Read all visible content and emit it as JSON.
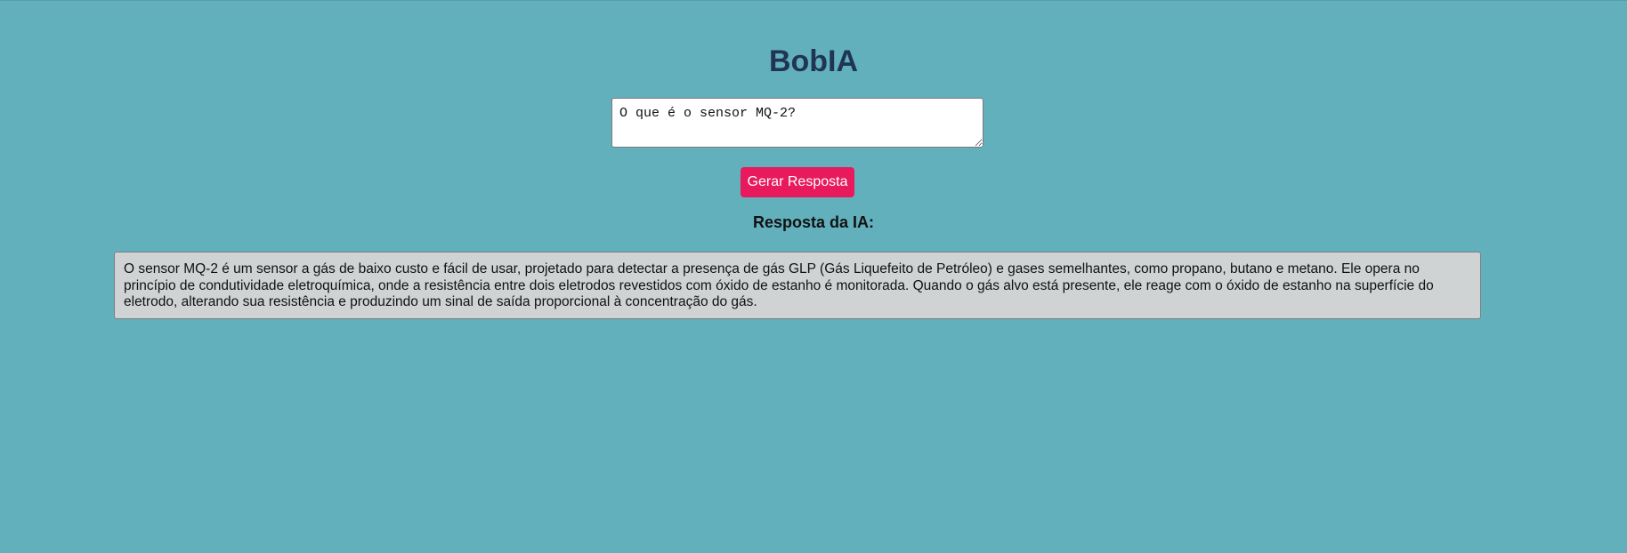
{
  "app": {
    "title": "BobIA"
  },
  "prompt": {
    "value": "O que é o sensor MQ-2?"
  },
  "actions": {
    "generate_label": "Gerar Resposta"
  },
  "response": {
    "heading": "Resposta da IA:",
    "text": "O sensor MQ-2 é um sensor a gás de baixo custo e fácil de usar, projetado para detectar a presença de gás GLP (Gás Liquefeito de Petróleo) e gases semelhantes, como propano, butano e metano. Ele opera no princípio de condutividade eletroquímica, onde a resistência entre dois eletrodos revestidos com óxido de estanho é monitorada. Quando o gás alvo está presente, ele reage com o óxido de estanho na superfície do eletrodo, alterando sua resistência e produzindo um sinal de saída proporcional à concentração do gás."
  },
  "colors": {
    "background": "#63b0bd",
    "title": "#1f3553",
    "button": "#e81a5d",
    "response_box": "#d0d3d4"
  }
}
